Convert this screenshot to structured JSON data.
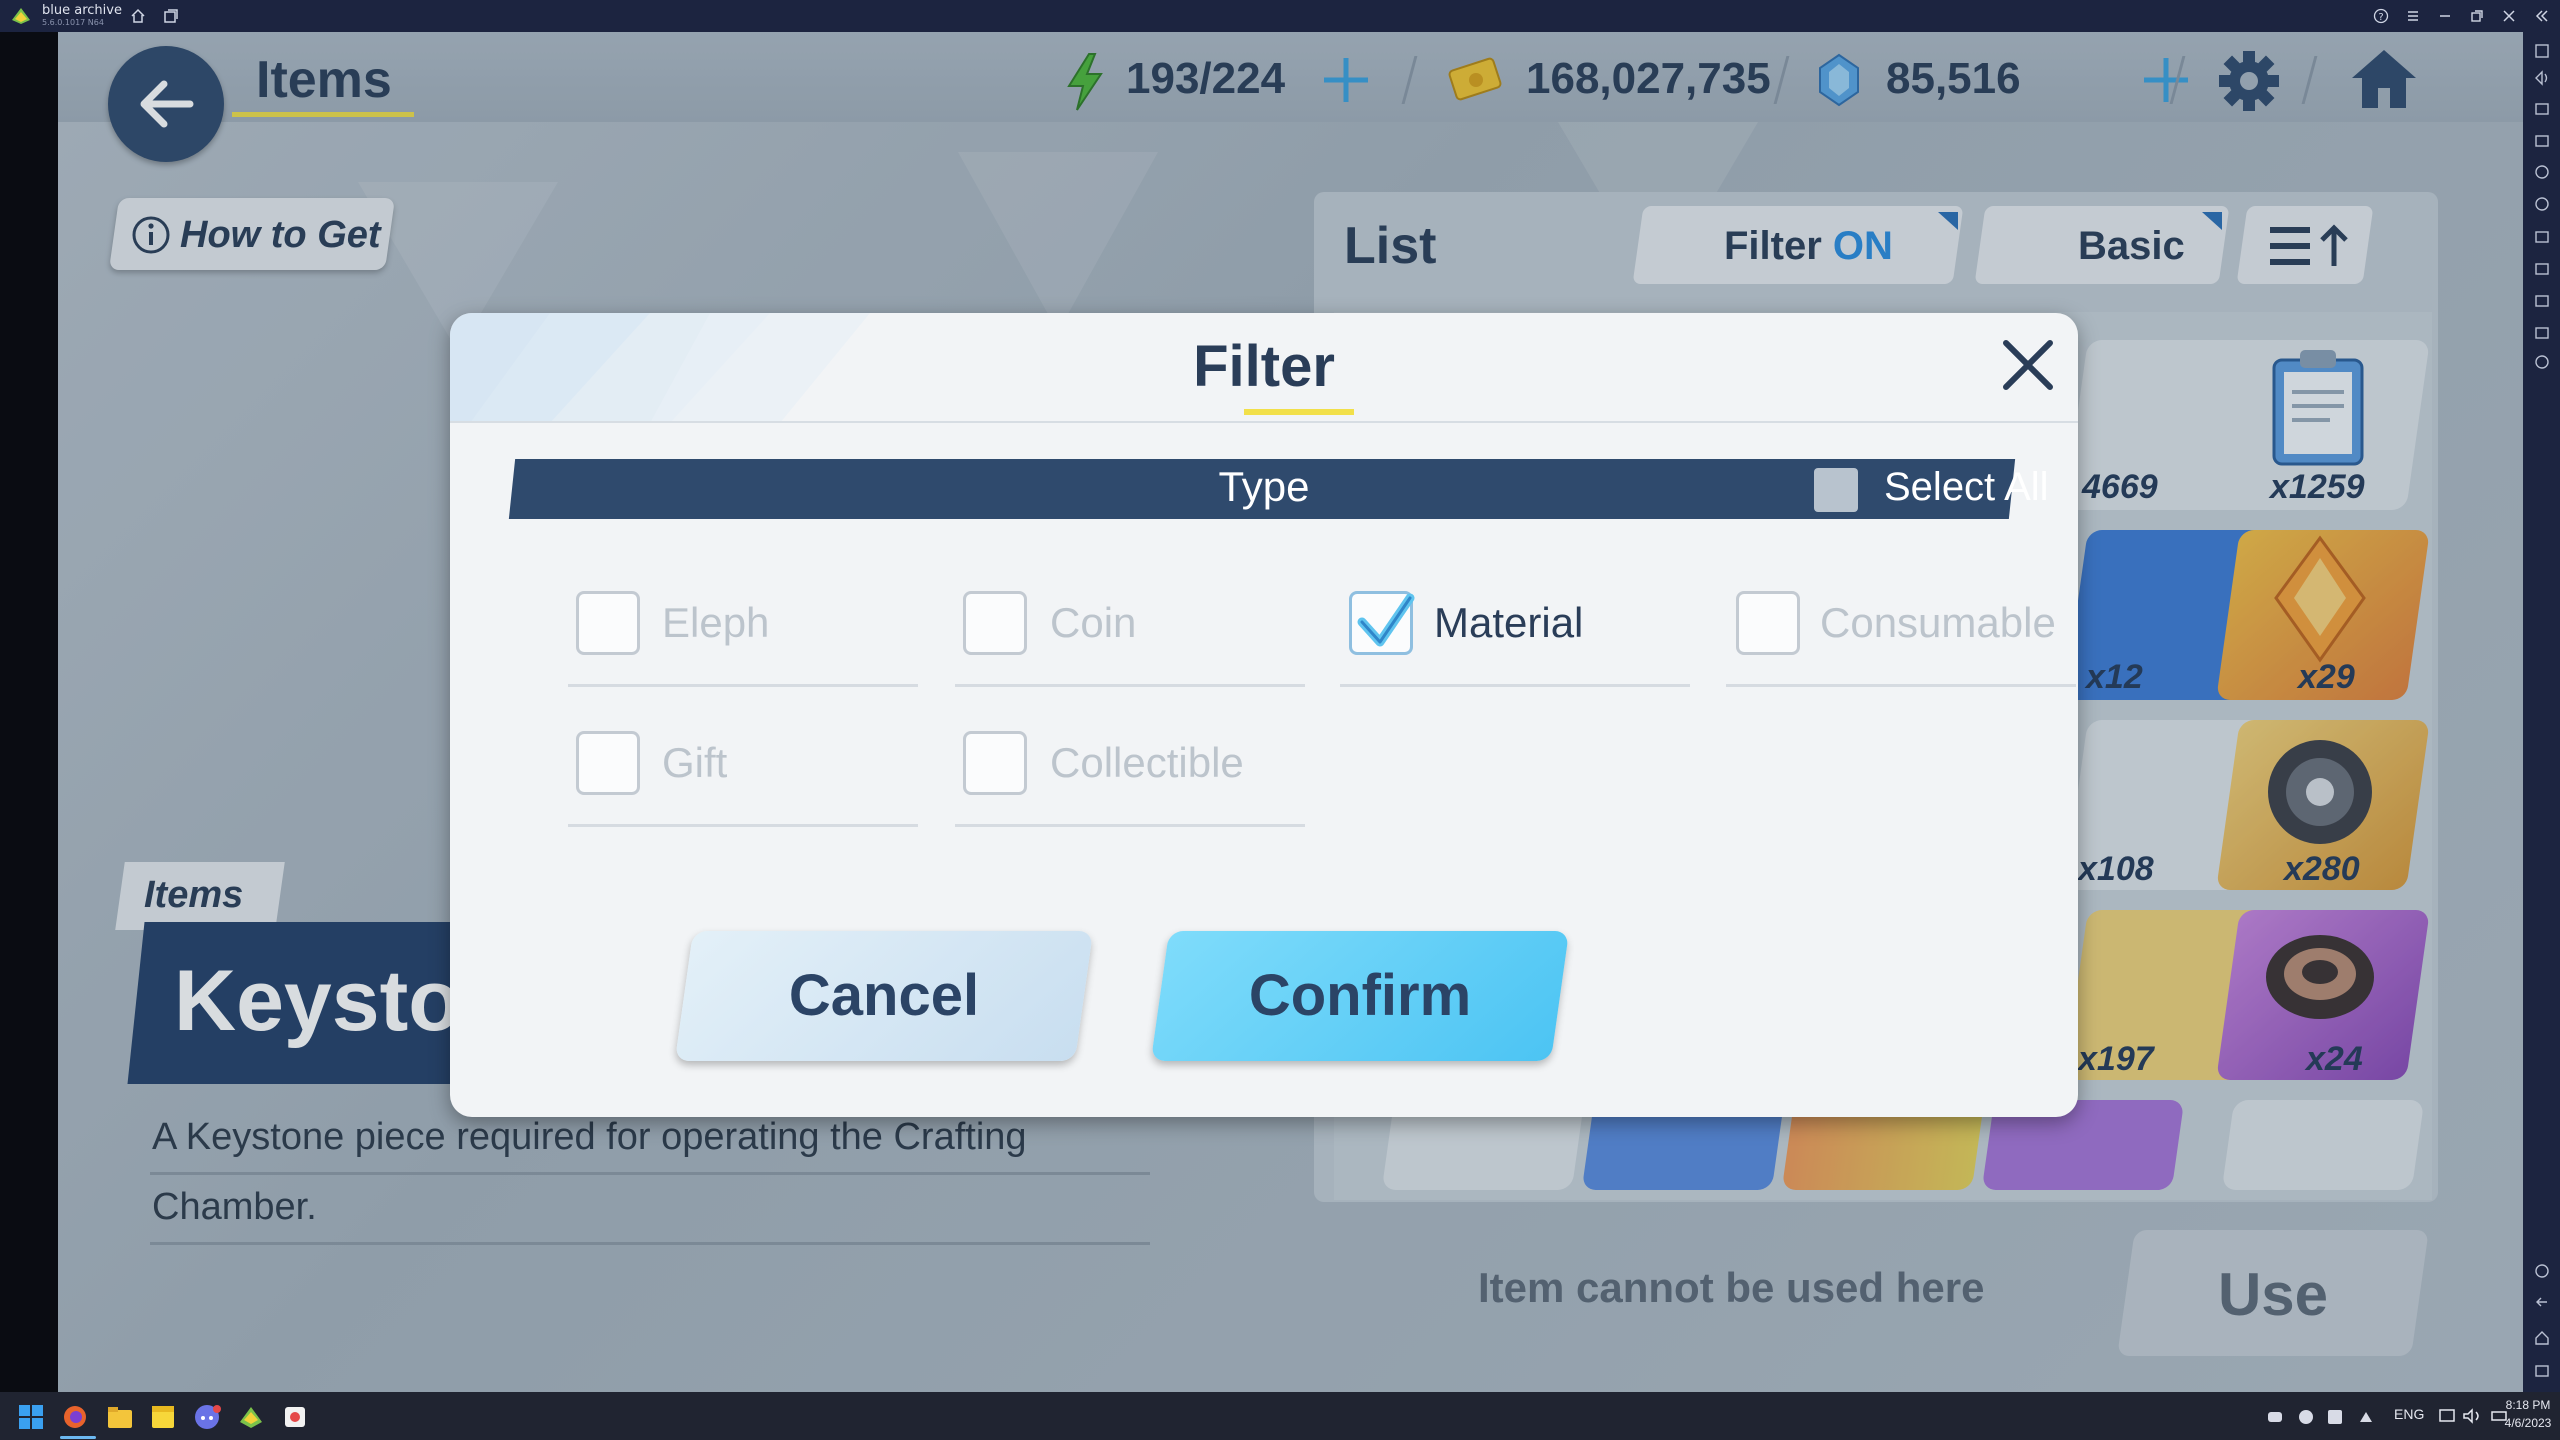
{
  "window": {
    "app_name": "blue archive",
    "version": "5.6.0.1017 N64"
  },
  "header": {
    "title": "Items",
    "stamina": "193/224",
    "credits": "168,027,735",
    "pyroxene": "85,516"
  },
  "left_panel": {
    "how_to_get": "How to Get",
    "category_tag": "Items",
    "item_name": "Keystor",
    "description_line1": "A Keystone piece required for operating the Crafting",
    "description_line2": "Chamber."
  },
  "list_panel": {
    "title": "List",
    "filter_label": "Filter",
    "filter_state": "ON",
    "sort_label": "Basic",
    "tiles": [
      {
        "count": "4669"
      },
      {
        "count": "x1259"
      },
      {
        "count": "x12"
      },
      {
        "count": "x29"
      },
      {
        "count": "x108"
      },
      {
        "count": "x280"
      },
      {
        "count": "x197"
      },
      {
        "count": "x24"
      }
    ]
  },
  "footer": {
    "notice": "Item cannot be used here",
    "use_button": "Use"
  },
  "filter_modal": {
    "title": "Filter",
    "section_title": "Type",
    "select_all_label": "Select All",
    "options": [
      {
        "label": "Eleph",
        "checked": false
      },
      {
        "label": "Coin",
        "checked": false
      },
      {
        "label": "Material",
        "checked": true
      },
      {
        "label": "Consumable",
        "checked": false
      },
      {
        "label": "Gift",
        "checked": false
      },
      {
        "label": "Collectible",
        "checked": false
      }
    ],
    "cancel_label": "Cancel",
    "confirm_label": "Confirm"
  },
  "taskbar": {
    "language": "ENG",
    "time": "8:18 PM",
    "date": "4/6/2023"
  },
  "colors": {
    "accent_blue": "#5fd0f7",
    "navy": "#2f4a6d",
    "highlight_yellow": "#f2e04a"
  }
}
